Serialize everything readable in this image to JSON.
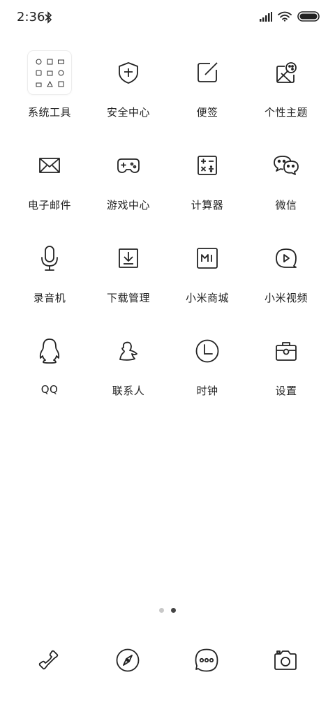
{
  "status_bar": {
    "time": "2:36",
    "icons": [
      "bluetooth-icon",
      "signal-icon",
      "wifi-icon",
      "battery-icon"
    ]
  },
  "apps": [
    {
      "label": "系统工具",
      "icon": "folder-grid-icon"
    },
    {
      "label": "安全中心",
      "icon": "shield-plus-icon"
    },
    {
      "label": "便签",
      "icon": "note-pen-icon"
    },
    {
      "label": "个性主题",
      "icon": "theme-palette-icon"
    },
    {
      "label": "电子邮件",
      "icon": "envelope-icon"
    },
    {
      "label": "游戏中心",
      "icon": "gamepad-icon"
    },
    {
      "label": "计算器",
      "icon": "calculator-icon"
    },
    {
      "label": "微信",
      "icon": "wechat-icon"
    },
    {
      "label": "录音机",
      "icon": "microphone-icon"
    },
    {
      "label": "下载管理",
      "icon": "download-icon"
    },
    {
      "label": "小米商城",
      "icon": "mi-store-icon"
    },
    {
      "label": "小米视频",
      "icon": "video-play-icon"
    },
    {
      "label": "QQ",
      "icon": "qq-penguin-icon"
    },
    {
      "label": "联系人",
      "icon": "contact-person-icon"
    },
    {
      "label": "时钟",
      "icon": "clock-icon"
    },
    {
      "label": "设置",
      "icon": "settings-toolbox-icon"
    }
  ],
  "page_indicator": {
    "pages": 2,
    "current": 2
  },
  "dock": [
    {
      "icon": "phone-icon"
    },
    {
      "icon": "compass-browser-icon"
    },
    {
      "icon": "message-bubble-icon"
    },
    {
      "icon": "camera-icon"
    }
  ],
  "colors": {
    "background": "#ffffff",
    "icon_stroke": "#222222",
    "dot_inactive": "#c8c8c8",
    "dot_active": "#444444"
  }
}
